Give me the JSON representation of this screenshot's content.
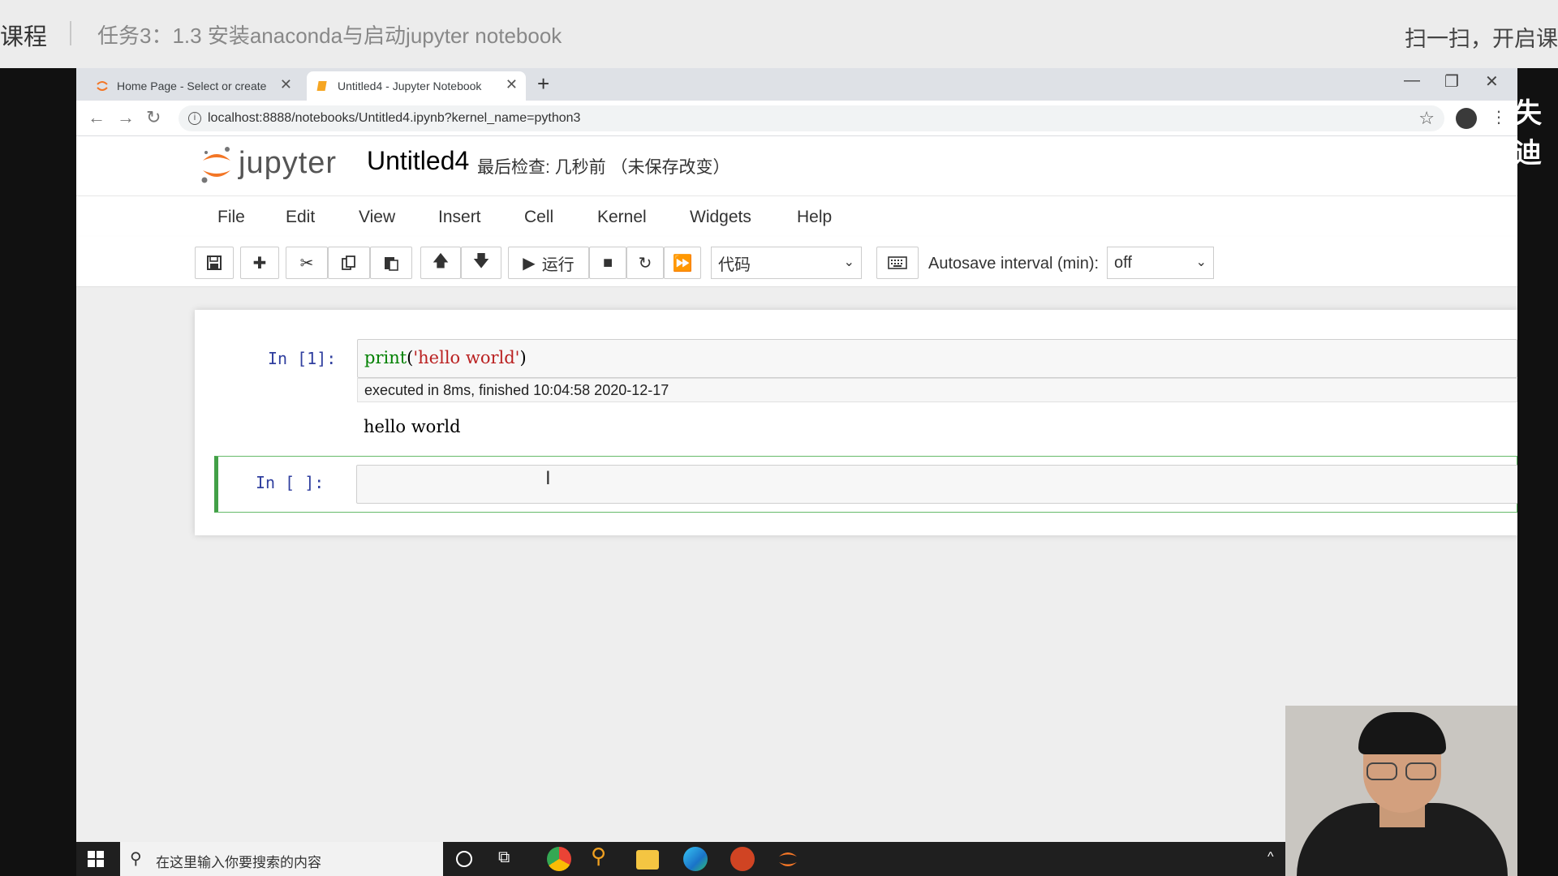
{
  "course": {
    "left_text": "课程",
    "title": "任务3：1.3 安装anaconda与启动jupyter notebook",
    "right_text": "扫一扫，开启课",
    "side_logo": "失迪"
  },
  "browser": {
    "tabs": [
      {
        "label": "Home Page - Select or create",
        "active": false
      },
      {
        "label": "Untitled4 - Jupyter Notebook",
        "active": true
      }
    ],
    "new_tab": "+",
    "url": "localhost:8888/notebooks/Untitled4.ipynb?kernel_name=python3"
  },
  "jupyter": {
    "logo_text": "jupyter",
    "notebook_name": "Untitled4",
    "checkpoint": "最后检查: 几秒前 （未保存改变）",
    "menu": [
      "File",
      "Edit",
      "View",
      "Insert",
      "Cell",
      "Kernel",
      "Widgets",
      "Help"
    ],
    "toolbar": {
      "run_label": "运行",
      "cell_type": "代码",
      "autosave_label": "Autosave interval (min):",
      "autosave_value": "off"
    },
    "cells": [
      {
        "prompt": "In  [1]:",
        "code_func": "print",
        "code_open": "(",
        "code_string": "'hello world'",
        "code_close": ")",
        "exec_info": "executed in 8ms, finished 10:04:58 2020-12-17",
        "output": "hello world"
      },
      {
        "prompt": "In  [ ]:",
        "code": ""
      }
    ]
  },
  "taskbar": {
    "search_placeholder": "在这里输入你要搜索的内容",
    "apps": [
      "cortana-icon",
      "task-view-icon",
      "chrome-icon",
      "search-app-icon",
      "file-explorer-icon",
      "edge-icon",
      "powerpoint-icon",
      "jupyter-icon"
    ]
  }
}
